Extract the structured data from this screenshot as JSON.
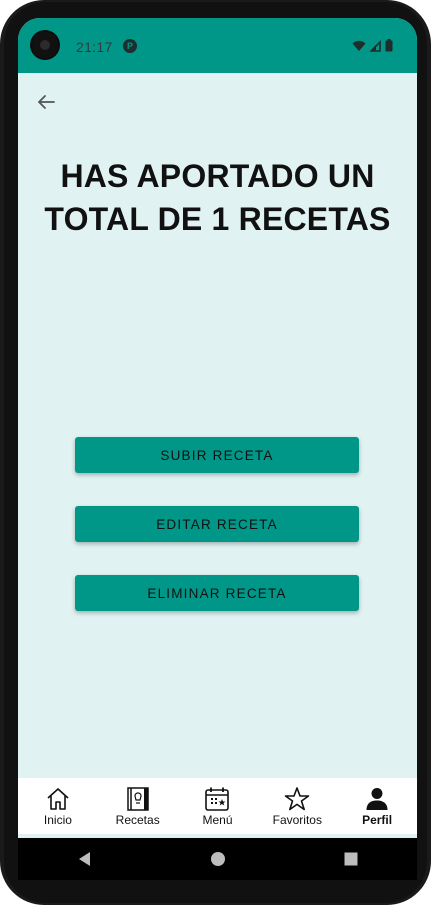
{
  "status_bar": {
    "time": "21:17",
    "notification_icon": "app-notification-icon",
    "wifi_icon": "wifi-icon",
    "signal_icon": "signal-icon",
    "battery_icon": "battery-icon",
    "bar_color": "#009688"
  },
  "top_bar": {
    "back_icon": "arrow-left-icon"
  },
  "main": {
    "headline": "HAS APORTADO UN TOTAL DE 1 RECETAS",
    "buttons": [
      {
        "label": "SUBIR RECETA"
      },
      {
        "label": "EDITAR RECETA"
      },
      {
        "label": "ELIMINAR RECETA"
      }
    ]
  },
  "bottom_nav": {
    "items": [
      {
        "label": "Inicio",
        "icon": "home-icon",
        "active": false
      },
      {
        "label": "Recetas",
        "icon": "recipe-book-icon",
        "active": false
      },
      {
        "label": "Menú",
        "icon": "calendar-icon",
        "active": false
      },
      {
        "label": "Favoritos",
        "icon": "star-icon",
        "active": false
      },
      {
        "label": "Perfil",
        "icon": "person-icon",
        "active": true
      }
    ]
  },
  "system_nav": {
    "back_icon": "triangle-back-icon",
    "home_icon": "circle-home-icon",
    "recents_icon": "square-recents-icon"
  },
  "colors": {
    "accent": "#009688",
    "background": "#e0f2f1"
  }
}
